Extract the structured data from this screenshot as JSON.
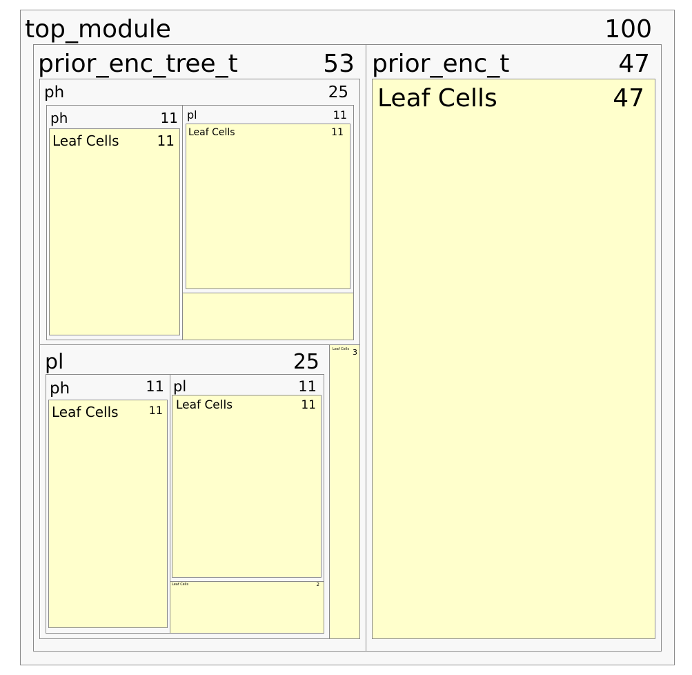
{
  "chart_data": {
    "type": "treemap",
    "root": {
      "name": "top_module",
      "value": "100",
      "children": [
        {
          "name": "prior_enc_tree_t",
          "value": "53",
          "children": [
            {
              "name": "ph",
              "value": "25",
              "children": [
                {
                  "name": "ph",
                  "value": "11",
                  "children": [
                    {
                      "name": "Leaf Cells",
                      "value": "11"
                    }
                  ]
                },
                {
                  "name": "pl",
                  "value": "11",
                  "children": [
                    {
                      "name": "Leaf Cells",
                      "value": "11"
                    }
                  ]
                }
              ]
            },
            {
              "name": "pl",
              "value": "25",
              "children": [
                {
                  "name": "ph",
                  "value": "11",
                  "children": [
                    {
                      "name": "Leaf Cells",
                      "value": "11"
                    }
                  ]
                },
                {
                  "name": "pl",
                  "value": "11",
                  "children": [
                    {
                      "name": "Leaf Cells",
                      "value": "11"
                    },
                    {
                      "name": "Leaf Cells",
                      "value": "2"
                    }
                  ]
                },
                {
                  "name": "Leaf Cells",
                  "value": "3"
                }
              ]
            }
          ]
        },
        {
          "name": "prior_enc_t",
          "value": "47",
          "children": [
            {
              "name": "Leaf Cells",
              "value": "47"
            }
          ]
        }
      ]
    }
  },
  "colors": {
    "module_fill": "#f8f8f8",
    "leaf_fill": "#ffffcc",
    "border": "#8a8a8a"
  }
}
